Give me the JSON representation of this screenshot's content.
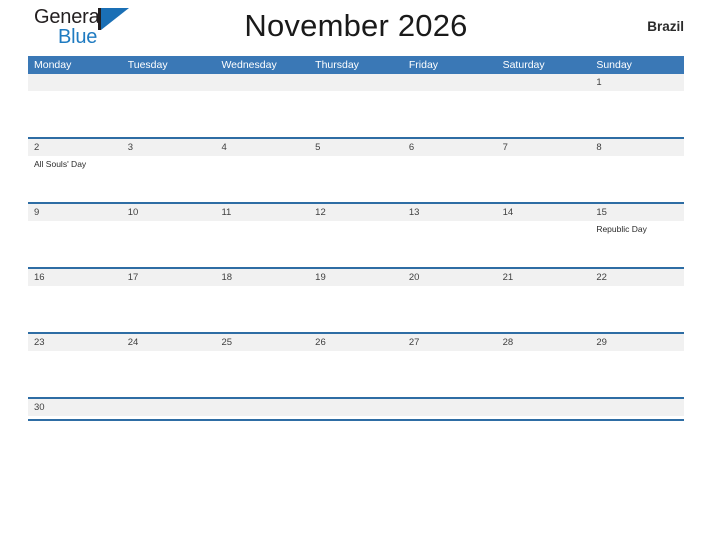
{
  "logo": {
    "word_one": "General",
    "word_two": "Blue",
    "mark": "triangle-logo-mark",
    "accent_color": "#1a6fb5"
  },
  "header": {
    "title": "November 2026",
    "country": "Brazil"
  },
  "theme": {
    "header_blue": "#3a78b6",
    "divider_blue": "#2e6da4",
    "date_strip_gray": "#f1f1f1",
    "text_dark": "#2b2b2b"
  },
  "calendar": {
    "weekdays": [
      "Monday",
      "Tuesday",
      "Wednesday",
      "Thursday",
      "Friday",
      "Saturday",
      "Sunday"
    ],
    "weeks": [
      {
        "days": [
          {
            "date": "",
            "event": ""
          },
          {
            "date": "",
            "event": ""
          },
          {
            "date": "",
            "event": ""
          },
          {
            "date": "",
            "event": ""
          },
          {
            "date": "",
            "event": ""
          },
          {
            "date": "",
            "event": ""
          },
          {
            "date": "1",
            "event": ""
          }
        ]
      },
      {
        "days": [
          {
            "date": "2",
            "event": "All Souls' Day"
          },
          {
            "date": "3",
            "event": ""
          },
          {
            "date": "4",
            "event": ""
          },
          {
            "date": "5",
            "event": ""
          },
          {
            "date": "6",
            "event": ""
          },
          {
            "date": "7",
            "event": ""
          },
          {
            "date": "8",
            "event": ""
          }
        ]
      },
      {
        "days": [
          {
            "date": "9",
            "event": ""
          },
          {
            "date": "10",
            "event": ""
          },
          {
            "date": "11",
            "event": ""
          },
          {
            "date": "12",
            "event": ""
          },
          {
            "date": "13",
            "event": ""
          },
          {
            "date": "14",
            "event": ""
          },
          {
            "date": "15",
            "event": "Republic Day"
          }
        ]
      },
      {
        "days": [
          {
            "date": "16",
            "event": ""
          },
          {
            "date": "17",
            "event": ""
          },
          {
            "date": "18",
            "event": ""
          },
          {
            "date": "19",
            "event": ""
          },
          {
            "date": "20",
            "event": ""
          },
          {
            "date": "21",
            "event": ""
          },
          {
            "date": "22",
            "event": ""
          }
        ]
      },
      {
        "days": [
          {
            "date": "23",
            "event": ""
          },
          {
            "date": "24",
            "event": ""
          },
          {
            "date": "25",
            "event": ""
          },
          {
            "date": "26",
            "event": ""
          },
          {
            "date": "27",
            "event": ""
          },
          {
            "date": "28",
            "event": ""
          },
          {
            "date": "29",
            "event": ""
          }
        ]
      },
      {
        "last": true,
        "days": [
          {
            "date": "30",
            "event": ""
          },
          {
            "date": "",
            "event": ""
          },
          {
            "date": "",
            "event": ""
          },
          {
            "date": "",
            "event": ""
          },
          {
            "date": "",
            "event": ""
          },
          {
            "date": "",
            "event": ""
          },
          {
            "date": "",
            "event": ""
          }
        ]
      }
    ]
  }
}
